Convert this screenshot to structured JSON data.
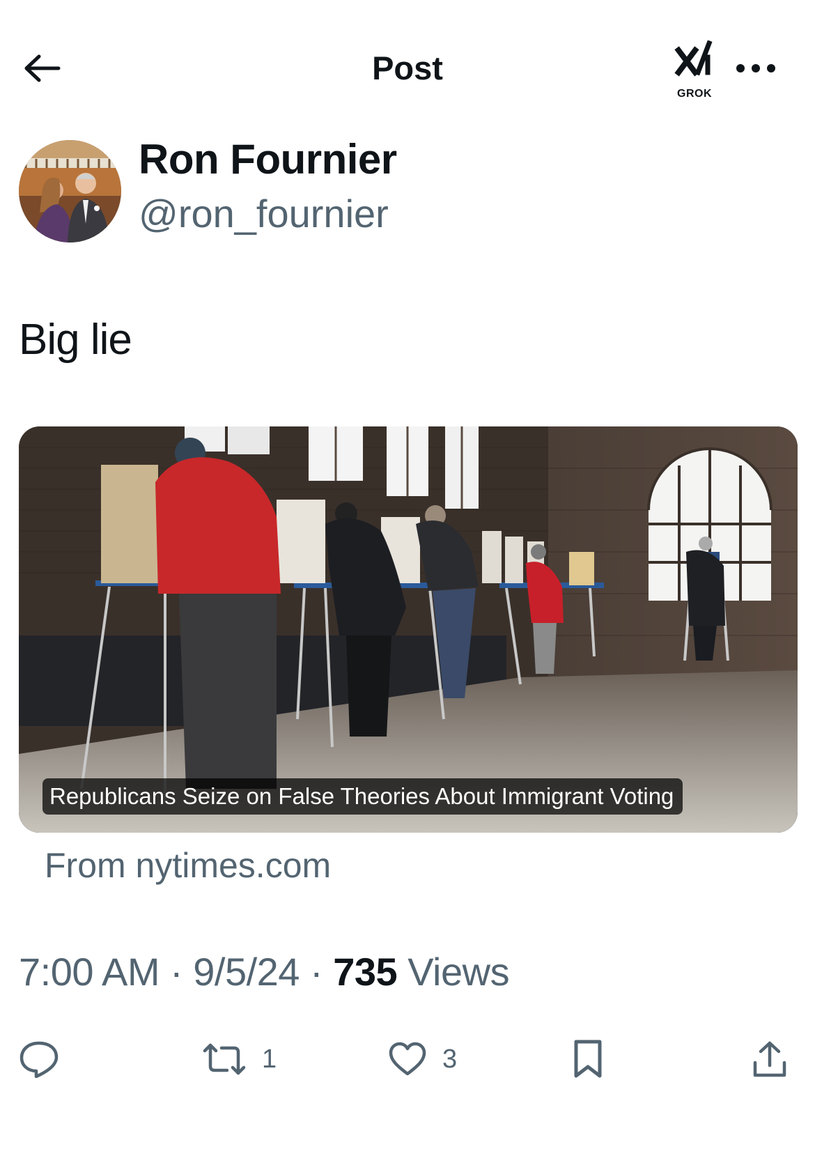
{
  "header": {
    "title": "Post",
    "grok_label": "GROK"
  },
  "author": {
    "name": "Ron Fournier",
    "handle": "@ron_fournier"
  },
  "post": {
    "text": "Big lie"
  },
  "link_card": {
    "headline": "Republicans Seize on False Theories About Immigrant Voting",
    "source": "From nytimes.com"
  },
  "meta": {
    "time": "7:00 AM",
    "sep1": " · ",
    "date": "9/5/24",
    "sep2": " · ",
    "views_count": "735",
    "views_label": " Views"
  },
  "actions": {
    "reply_icon": "speech-bubble-icon",
    "repost_count": "1",
    "like_count": "3",
    "bookmark_icon": "bookmark-icon",
    "share_icon": "share-upload-icon"
  },
  "colors": {
    "text_primary": "#0f1419",
    "text_secondary": "#536471",
    "background": "#ffffff"
  }
}
